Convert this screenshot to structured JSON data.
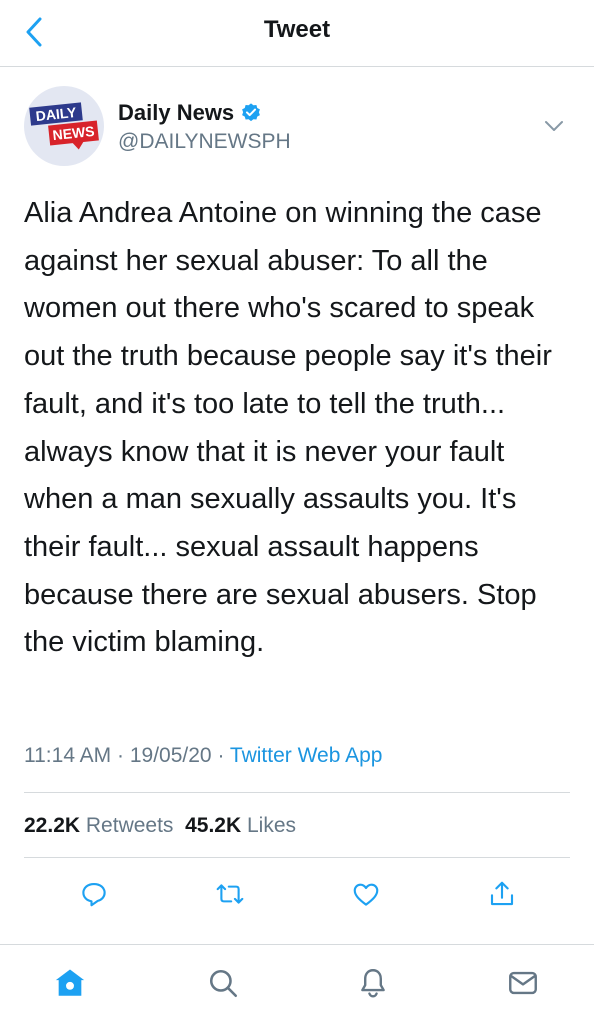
{
  "header": {
    "title": "Tweet",
    "back_icon": "chevron-left-icon"
  },
  "author": {
    "avatar_text_1": "DAILY",
    "avatar_text_2": "NEWS",
    "name": "Daily News",
    "handle": "@DAILYNEWSPH",
    "verified": true
  },
  "tweet": {
    "text": "Alia Andrea Antoine on winning the case against her sexual abuser: To all the women out there who's scared to speak out the truth because people say it's their fault, and it's too late to tell the truth... always know that it is never your fault when a man sexually assaults you. It's their fault... sexual assault happens because there are sexual abusers. Stop the victim blaming.",
    "time": "11:14 AM",
    "date": "19/05/20",
    "separator": "·",
    "source": "Twitter Web App"
  },
  "stats": {
    "retweets_count": "22.2K",
    "retweets_label": "Retweets",
    "likes_count": "45.2K",
    "likes_label": "Likes"
  },
  "actions": [
    "reply-icon",
    "retweet-icon",
    "like-icon",
    "share-icon"
  ],
  "tabs": [
    "home-icon",
    "search-icon",
    "notifications-icon",
    "messages-icon"
  ],
  "colors": {
    "accent": "#1da1f2",
    "link": "#1b95e0",
    "secondary_text": "#657786",
    "divider": "#d6dadd"
  }
}
